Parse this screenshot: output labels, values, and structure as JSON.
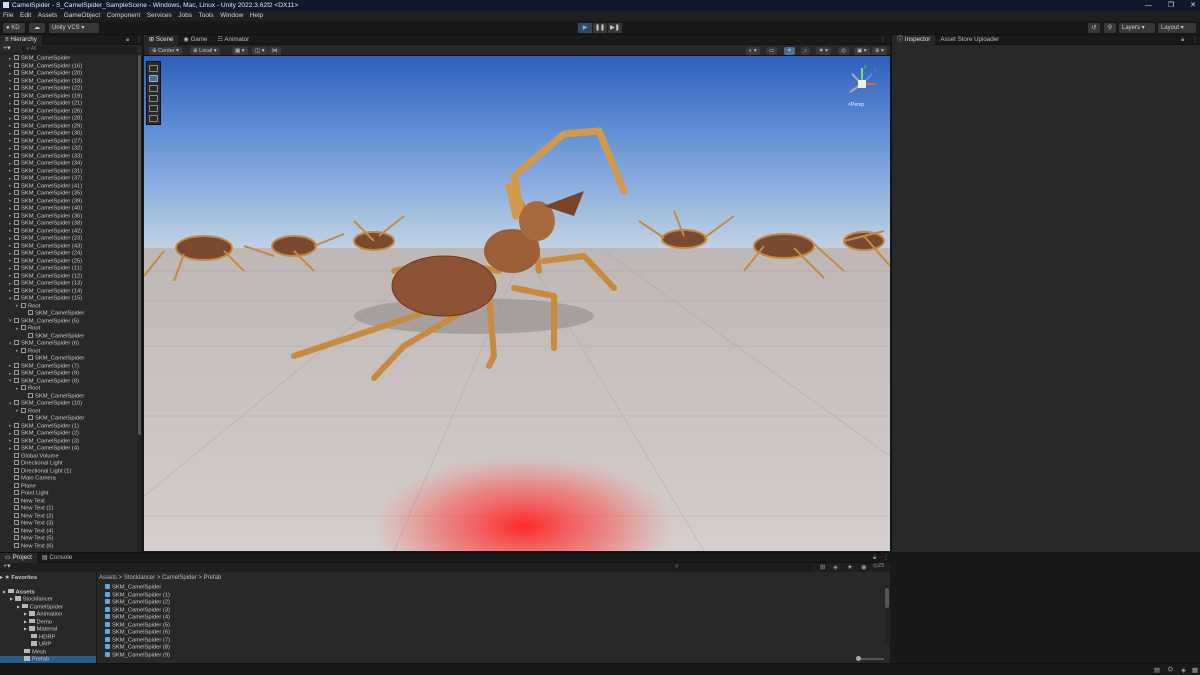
{
  "window": {
    "title": "CamelSpider - S_CamelSpider_SampleScene - Windows, Mac, Linux - Unity 2022.3.62f2 <DX11>"
  },
  "menu": [
    "File",
    "Edit",
    "Assets",
    "GameObject",
    "Component",
    "Services",
    "Jobs",
    "Tools",
    "Window",
    "Help"
  ],
  "toolbar": {
    "account": "KD",
    "version_control": "Unity VCS",
    "layers": "Layers",
    "layout": "Layout"
  },
  "hierarchy": {
    "tab": "Hierarchy",
    "search_placeholder": "All",
    "items": [
      {
        "label": "SKM_CamelSpider",
        "depth": 1,
        "arrow": "▶"
      },
      {
        "label": "SKM_CamelSpider (16)",
        "depth": 1,
        "arrow": "▶"
      },
      {
        "label": "SKM_CamelSpider (20)",
        "depth": 1,
        "arrow": "▶"
      },
      {
        "label": "SKM_CamelSpider (18)",
        "depth": 1,
        "arrow": "▶"
      },
      {
        "label": "SKM_CamelSpider (22)",
        "depth": 1,
        "arrow": "▶"
      },
      {
        "label": "SKM_CamelSpider (19)",
        "depth": 1,
        "arrow": "▶"
      },
      {
        "label": "SKM_CamelSpider (21)",
        "depth": 1,
        "arrow": "▶"
      },
      {
        "label": "SKM_CamelSpider (26)",
        "depth": 1,
        "arrow": "▶"
      },
      {
        "label": "SKM_CamelSpider (28)",
        "depth": 1,
        "arrow": "▶"
      },
      {
        "label": "SKM_CamelSpider (29)",
        "depth": 1,
        "arrow": "▶"
      },
      {
        "label": "SKM_CamelSpider (30)",
        "depth": 1,
        "arrow": "▶"
      },
      {
        "label": "SKM_CamelSpider (27)",
        "depth": 1,
        "arrow": "▶"
      },
      {
        "label": "SKM_CamelSpider (32)",
        "depth": 1,
        "arrow": "▶"
      },
      {
        "label": "SKM_CamelSpider (33)",
        "depth": 1,
        "arrow": "▶"
      },
      {
        "label": "SKM_CamelSpider (34)",
        "depth": 1,
        "arrow": "▶"
      },
      {
        "label": "SKM_CamelSpider (31)",
        "depth": 1,
        "arrow": "▶"
      },
      {
        "label": "SKM_CamelSpider (37)",
        "depth": 1,
        "arrow": "▶"
      },
      {
        "label": "SKM_CamelSpider (41)",
        "depth": 1,
        "arrow": "▶"
      },
      {
        "label": "SKM_CamelSpider (35)",
        "depth": 1,
        "arrow": "▶"
      },
      {
        "label": "SKM_CamelSpider (39)",
        "depth": 1,
        "arrow": "▶"
      },
      {
        "label": "SKM_CamelSpider (40)",
        "depth": 1,
        "arrow": "▶"
      },
      {
        "label": "SKM_CamelSpider (36)",
        "depth": 1,
        "arrow": "▶"
      },
      {
        "label": "SKM_CamelSpider (38)",
        "depth": 1,
        "arrow": "▶"
      },
      {
        "label": "SKM_CamelSpider (42)",
        "depth": 1,
        "arrow": "▶"
      },
      {
        "label": "SKM_CamelSpider (23)",
        "depth": 1,
        "arrow": "▶"
      },
      {
        "label": "SKM_CamelSpider (43)",
        "depth": 1,
        "arrow": "▶"
      },
      {
        "label": "SKM_CamelSpider (24)",
        "depth": 1,
        "arrow": "▶"
      },
      {
        "label": "SKM_CamelSpider (25)",
        "depth": 1,
        "arrow": "▶"
      },
      {
        "label": "SKM_CamelSpider (11)",
        "depth": 1,
        "arrow": "▶"
      },
      {
        "label": "SKM_CamelSpider (12)",
        "depth": 1,
        "arrow": "▶"
      },
      {
        "label": "SKM_CamelSpider (13)",
        "depth": 1,
        "arrow": "▶"
      },
      {
        "label": "SKM_CamelSpider (14)",
        "depth": 1,
        "arrow": "▶"
      },
      {
        "label": "SKM_CamelSpider (15)",
        "depth": 1,
        "arrow": "▼"
      },
      {
        "label": "Root",
        "depth": 2,
        "arrow": "▶"
      },
      {
        "label": "SKM_CamelSpider",
        "depth": 3,
        "arrow": ""
      },
      {
        "label": "SKM_CamelSpider (5)",
        "depth": 1,
        "arrow": "▼"
      },
      {
        "label": "Root",
        "depth": 2,
        "arrow": "▶"
      },
      {
        "label": "SKM_CamelSpider",
        "depth": 3,
        "arrow": ""
      },
      {
        "label": "SKM_CamelSpider (6)",
        "depth": 1,
        "arrow": "▼"
      },
      {
        "label": "Root",
        "depth": 2,
        "arrow": "▶"
      },
      {
        "label": "SKM_CamelSpider",
        "depth": 3,
        "arrow": ""
      },
      {
        "label": "SKM_CamelSpider (7)",
        "depth": 1,
        "arrow": "▶"
      },
      {
        "label": "SKM_CamelSpider (9)",
        "depth": 1,
        "arrow": "▶"
      },
      {
        "label": "SKM_CamelSpider (8)",
        "depth": 1,
        "arrow": "▼"
      },
      {
        "label": "Root",
        "depth": 2,
        "arrow": "▶"
      },
      {
        "label": "SKM_CamelSpider",
        "depth": 3,
        "arrow": ""
      },
      {
        "label": "SKM_CamelSpider (10)",
        "depth": 1,
        "arrow": "▼"
      },
      {
        "label": "Root",
        "depth": 2,
        "arrow": "▶"
      },
      {
        "label": "SKM_CamelSpider",
        "depth": 3,
        "arrow": ""
      },
      {
        "label": "SKM_CamelSpider (1)",
        "depth": 1,
        "arrow": "▶"
      },
      {
        "label": "SKM_CamelSpider (2)",
        "depth": 1,
        "arrow": "▶"
      },
      {
        "label": "SKM_CamelSpider (3)",
        "depth": 1,
        "arrow": "▶"
      },
      {
        "label": "SKM_CamelSpider (4)",
        "depth": 1,
        "arrow": "▶"
      },
      {
        "label": "Global Volume",
        "depth": 1,
        "arrow": ""
      },
      {
        "label": "Directional Light",
        "depth": 1,
        "arrow": ""
      },
      {
        "label": "Directional Light (1)",
        "depth": 1,
        "arrow": ""
      },
      {
        "label": "Main Camera",
        "depth": 1,
        "arrow": ""
      },
      {
        "label": "Plane",
        "depth": 1,
        "arrow": ""
      },
      {
        "label": "Point Light",
        "depth": 1,
        "arrow": ""
      },
      {
        "label": "New Text",
        "depth": 1,
        "arrow": ""
      },
      {
        "label": "New Text (1)",
        "depth": 1,
        "arrow": ""
      },
      {
        "label": "New Text (2)",
        "depth": 1,
        "arrow": ""
      },
      {
        "label": "New Text (3)",
        "depth": 1,
        "arrow": ""
      },
      {
        "label": "New Text (4)",
        "depth": 1,
        "arrow": ""
      },
      {
        "label": "New Text (5)",
        "depth": 1,
        "arrow": ""
      },
      {
        "label": "New Text (6)",
        "depth": 1,
        "arrow": ""
      }
    ]
  },
  "scene": {
    "tabs": [
      "Scene",
      "Game",
      "Animator"
    ],
    "pivot": "Center",
    "space": "Local",
    "gizmo_label": "<Persp"
  },
  "inspector": {
    "tabs": [
      "Inspector",
      "Asset Store Uploader"
    ]
  },
  "project": {
    "tabs": [
      "Project",
      "Console"
    ],
    "count": "23",
    "favorites": "Favorites",
    "tree": [
      {
        "label": "Assets",
        "depth": 0,
        "bold": true
      },
      {
        "label": "Stocklancer",
        "depth": 1
      },
      {
        "label": "CamelSpider",
        "depth": 2
      },
      {
        "label": "Animation",
        "depth": 3
      },
      {
        "label": "Demo",
        "depth": 3
      },
      {
        "label": "Material",
        "depth": 3
      },
      {
        "label": "HDRP",
        "depth": 4
      },
      {
        "label": "URP",
        "depth": 4
      },
      {
        "label": "Mesh",
        "depth": 3
      },
      {
        "label": "Prefab",
        "depth": 3,
        "selected": true
      },
      {
        "label": "Texture",
        "depth": 3
      }
    ],
    "breadcrumb": [
      "Assets",
      "Stocklancer",
      "CamelSpider",
      "Prefab"
    ],
    "assets": [
      "SKM_CamelSpider",
      "SKM_CamelSpider (1)",
      "SKM_CamelSpider (2)",
      "SKM_CamelSpider (3)",
      "SKM_CamelSpider (4)",
      "SKM_CamelSpider (5)",
      "SKM_CamelSpider (6)",
      "SKM_CamelSpider (7)",
      "SKM_CamelSpider (8)",
      "SKM_CamelSpider (9)"
    ]
  },
  "colors": {
    "accent": "#2c5d87",
    "play_active": "#6fb2ff",
    "sky_top": "#2f5fbf",
    "ground": "#cdc6c2",
    "spider": "#c78a3f"
  }
}
